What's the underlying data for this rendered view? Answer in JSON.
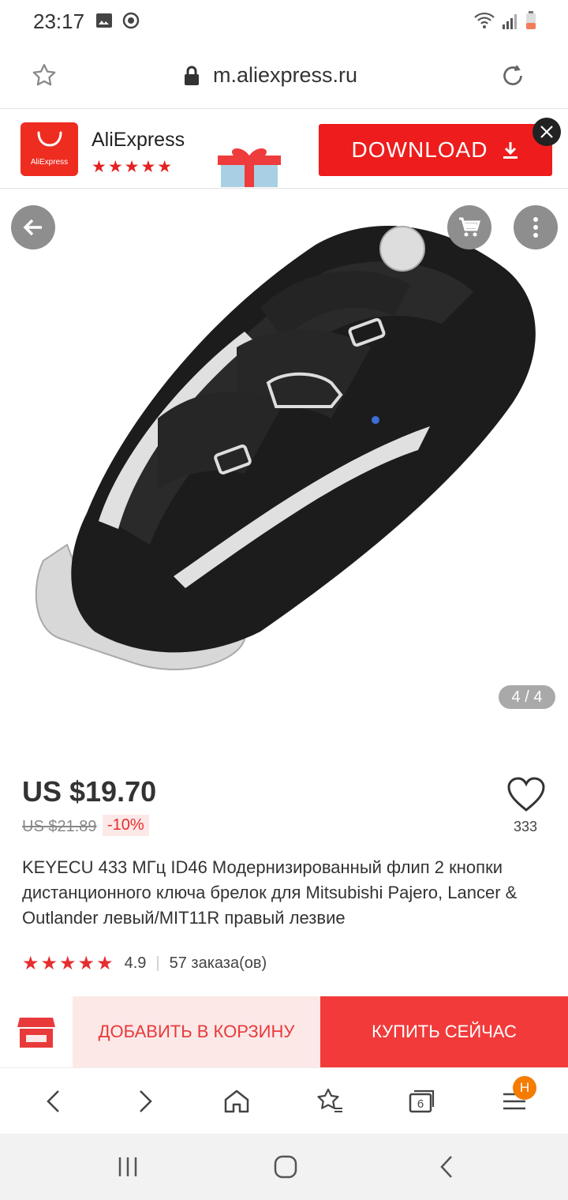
{
  "status_bar": {
    "time": "23:17"
  },
  "browser": {
    "url": "m.aliexpress.ru"
  },
  "app_banner": {
    "app_name": "AliExpress",
    "logo_text": "AliExpress",
    "rating_stars": "★★★★★",
    "download_label": "DOWNLOAD"
  },
  "gallery": {
    "counter": "4 / 4"
  },
  "product": {
    "price": "US $19.70",
    "old_price": "US $21.89",
    "discount": "-10%",
    "wishlist_count": "333",
    "title": "KEYECU 433 МГц ID46 Модернизированный флип 2 кнопки дистанционного ключа брелок для Mitsubishi Pajero, Lancer & Outlander левый/MIT11R правый лезвие",
    "rating_stars": "★★★★★",
    "rating": "4.9",
    "orders": "57 заказа(ов)"
  },
  "actions": {
    "add_to_cart": "ДОБАВИТЬ В КОРЗИНУ",
    "buy_now": "КУПИТЬ СЕЙЧАС"
  },
  "browser_nav": {
    "tabs_count": "6",
    "menu_badge": "H"
  },
  "colors": {
    "accent": "#f23a3a",
    "accent_light": "#fde8e8",
    "badge": "#f57c00"
  }
}
